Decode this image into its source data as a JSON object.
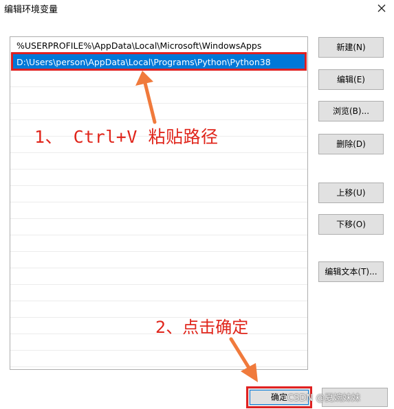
{
  "window": {
    "title": "编辑环境变量",
    "close_icon": "close-icon"
  },
  "path_list": {
    "items": [
      "%USERPROFILE%\\AppData\\Local\\Microsoft\\WindowsApps",
      "D:\\Users\\person\\AppData\\Local\\Programs\\Python\\Python38"
    ],
    "selected_index": 1
  },
  "buttons": {
    "new": "新建(N)",
    "edit": "编辑(E)",
    "browse": "浏览(B)...",
    "delete": "删除(D)",
    "move_up": "上移(U)",
    "move_down": "下移(O)",
    "edit_text": "编辑文本(T)...",
    "ok": "确定"
  },
  "annotations": {
    "step1": "1、 Ctrl+V 粘贴路径",
    "step2": "2、点击确定",
    "color": "#e0251b"
  },
  "watermark": "CSDN @夏婉妹妹",
  "colors": {
    "selection": "#0078d7",
    "highlight_box": "#e02020",
    "button_face": "#e1e1e1"
  }
}
